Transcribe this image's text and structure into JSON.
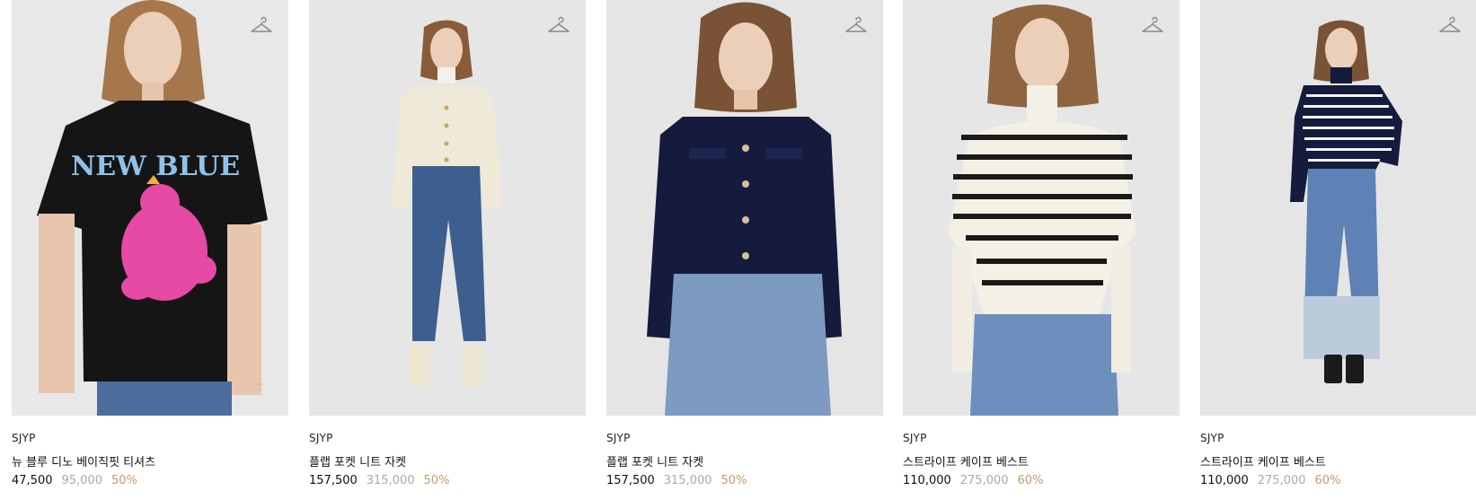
{
  "colors": {
    "background": "#ffffff",
    "photo_background": "#e7e7e7",
    "discount": "#c49a6c",
    "original_price": "#aaaaaa",
    "text": "#111111"
  },
  "products": [
    {
      "brand": "SJYP",
      "name": "뉴 블루 디노 베이직핏 티셔츠",
      "sale_price": "47,500",
      "original_price": "95,000",
      "discount": "50%",
      "image": "model-black-tshirt-jeans",
      "print_text": "NEW BLUE",
      "icon": "hanger-icon"
    },
    {
      "brand": "SJYP",
      "name": "플랩 포켓 니트 자켓",
      "sale_price": "157,500",
      "original_price": "315,000",
      "discount": "50%",
      "image": "model-ivory-knit-jacket-bootcut-jeans",
      "icon": "hanger-icon"
    },
    {
      "brand": "SJYP",
      "name": "플랩 포켓 니트 자켓",
      "sale_price": "157,500",
      "original_price": "315,000",
      "discount": "50%",
      "image": "model-navy-knit-jacket-wide-jeans",
      "icon": "hanger-icon"
    },
    {
      "brand": "SJYP",
      "name": "스트라이프 케이프 베스트",
      "sale_price": "110,000",
      "original_price": "275,000",
      "discount": "60%",
      "image": "model-ivory-striped-cape-vest",
      "icon": "hanger-icon"
    },
    {
      "brand": "SJYP",
      "name": "스트라이프 케이프 베스트",
      "sale_price": "110,000",
      "original_price": "275,000",
      "discount": "60%",
      "image": "model-navy-striped-cape-vest",
      "icon": "hanger-icon"
    }
  ]
}
